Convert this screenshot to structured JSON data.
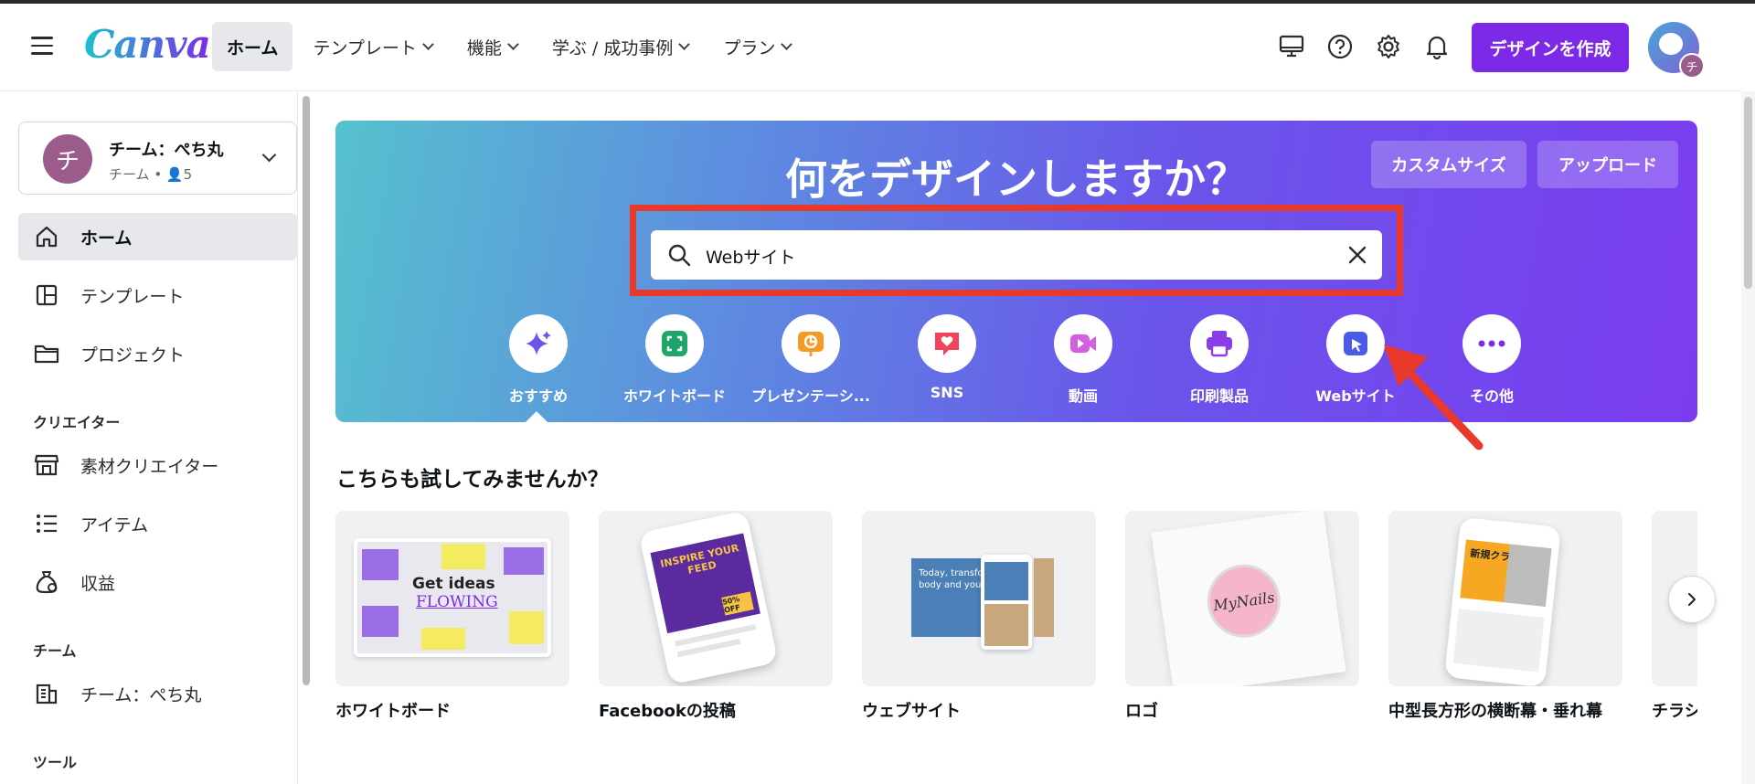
{
  "header": {
    "logo": "Canva",
    "nav": [
      {
        "label": "ホーム",
        "active": true,
        "has_menu": false
      },
      {
        "label": "テンプレート",
        "active": false,
        "has_menu": true
      },
      {
        "label": "機能",
        "active": false,
        "has_menu": true
      },
      {
        "label": "学ぶ / 成功事例",
        "active": false,
        "has_menu": true
      },
      {
        "label": "プラン",
        "active": false,
        "has_menu": true
      }
    ],
    "icons": [
      "desktop-icon",
      "help-icon",
      "settings-icon",
      "bell-icon"
    ],
    "create_label": "デザインを作成",
    "avatar_initial": "チ",
    "accent_color": "#7d2ae8"
  },
  "sidebar": {
    "team": {
      "avatar": "チ",
      "name": "チーム：ぺち丸",
      "sub": "チーム • 👤5"
    },
    "items": [
      {
        "label": "ホーム",
        "icon": "home-icon",
        "active": true
      },
      {
        "label": "テンプレート",
        "icon": "template-icon",
        "active": false
      },
      {
        "label": "プロジェクト",
        "icon": "folder-icon",
        "active": false
      }
    ],
    "creator_section": "クリエイター",
    "creator_items": [
      {
        "label": "素材クリエイター",
        "icon": "store-icon"
      },
      {
        "label": "アイテム",
        "icon": "list-icon"
      },
      {
        "label": "収益",
        "icon": "money-bag-icon"
      }
    ],
    "team_section": "チーム",
    "team_items": [
      {
        "label": "チーム：ぺち丸",
        "icon": "building-icon"
      }
    ],
    "tools_section": "ツール"
  },
  "hero": {
    "title": "何をデザインしますか？",
    "custom_size": "カスタムサイズ",
    "upload": "アップロード",
    "search_value": "Webサイト",
    "categories": [
      {
        "label": "おすすめ",
        "icon": "sparkle-icon",
        "color": "#6a55ea"
      },
      {
        "label": "ホワイトボード",
        "icon": "whiteboard-icon",
        "color": "#1fa56a"
      },
      {
        "label": "プレゼンテーシ...",
        "icon": "presentation-icon",
        "color": "#f59b23"
      },
      {
        "label": "SNS",
        "icon": "heart-icon",
        "color": "#f0445a"
      },
      {
        "label": "動画",
        "icon": "video-icon",
        "color": "#d45fe0"
      },
      {
        "label": "印刷製品",
        "icon": "printer-icon",
        "color": "#8a3ee8"
      },
      {
        "label": "Webサイト",
        "icon": "website-icon",
        "color": "#4a5be8"
      },
      {
        "label": "その他",
        "icon": "more-icon",
        "color": "#7d2ae8"
      }
    ],
    "highlight_color": "#e8392b"
  },
  "suggestions": {
    "title": "こちらも試してみませんか？",
    "cards": [
      {
        "label": "ホワイトボード",
        "thumb_text_1": "Get ideas",
        "thumb_text_2": "FLOWING"
      },
      {
        "label": "Facebookの投稿",
        "thumb_text_1": "INSPIRE YOUR FEED",
        "thumb_text_2": "50% OFF"
      },
      {
        "label": "ウェブサイト",
        "thumb_text_1": "Today, transform your body and your life.",
        "thumb_text_2": ""
      },
      {
        "label": "ロゴ",
        "thumb_text_1": "MyNails",
        "thumb_text_2": ""
      },
      {
        "label": "中型長方形の横断幕・垂れ幕",
        "thumb_text_1": "新規クラス",
        "thumb_text_2": ""
      },
      {
        "label": "チラシ",
        "thumb_text_1": "",
        "thumb_text_2": ""
      }
    ]
  }
}
